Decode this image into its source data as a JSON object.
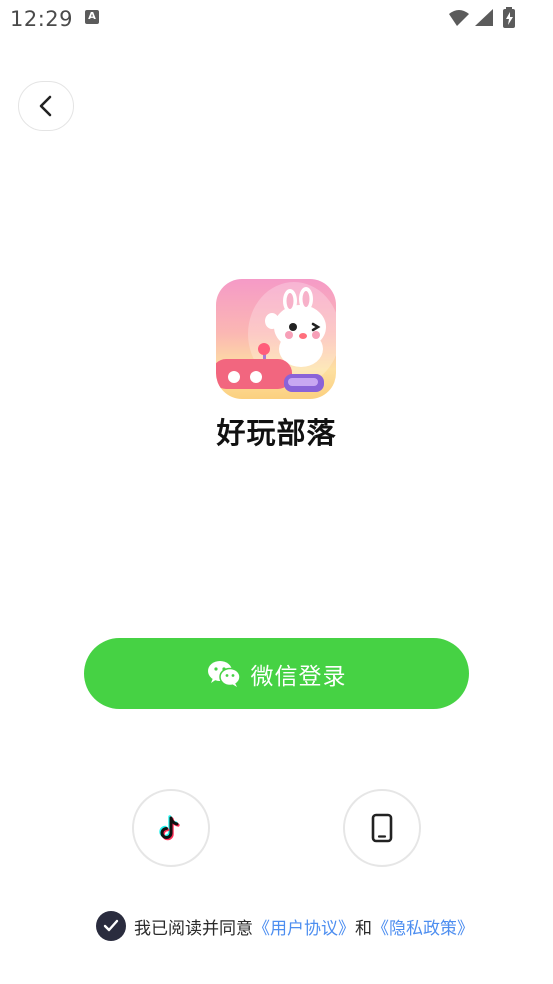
{
  "status_bar": {
    "time": "12:29",
    "notification_icon_letter": "A"
  },
  "header": {
    "back_icon": "chevron-left-icon"
  },
  "app": {
    "name": "好玩部落",
    "logo_icon": "bunny-logo-icon"
  },
  "login": {
    "wechat_label": "微信登录",
    "wechat_icon": "wechat-icon",
    "wechat_color": "#46d244",
    "alt_methods": [
      {
        "icon": "tiktok-icon"
      },
      {
        "icon": "phone-icon"
      }
    ]
  },
  "agreement": {
    "checked": true,
    "prefix": "我已阅读并同意",
    "user_agreement": "《用户协议》",
    "conjunction": "和",
    "privacy_policy": "《隐私政策》",
    "link_color": "#4d8ef0"
  }
}
